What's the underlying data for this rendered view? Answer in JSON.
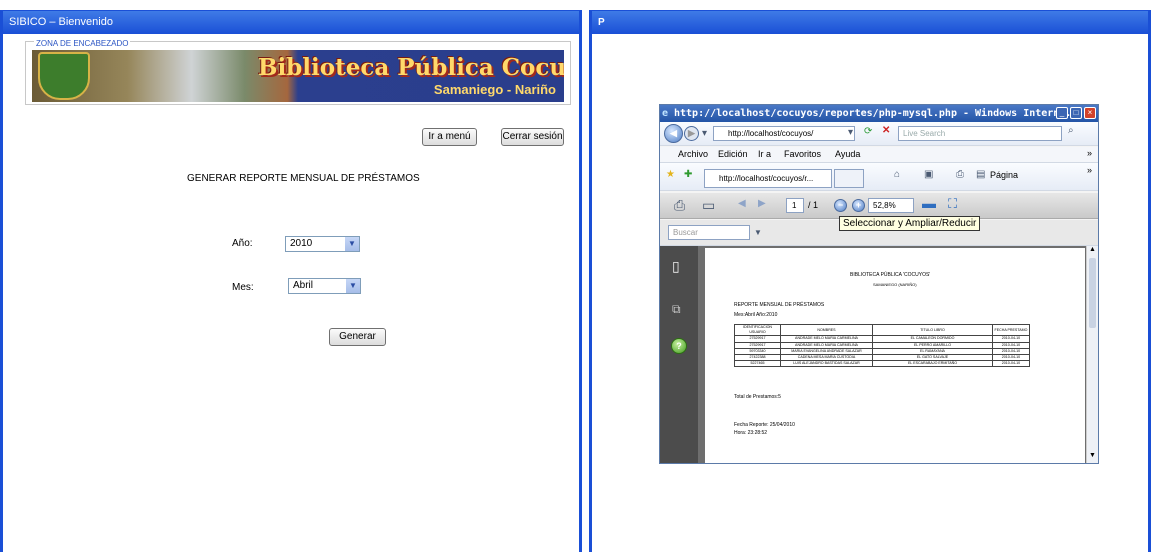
{
  "left": {
    "title": "SIBICO – Bienvenido",
    "header_zone_label": "ZONA DE ENCABEZADO",
    "banner_title": "Biblioteca Pública Cocuyos",
    "banner_subtitle": "Samaniego - Nariño",
    "menu_button": "Ir a menú",
    "logout_button": "Cerrar sesión",
    "page_heading": "GENERAR REPORTE MENSUAL DE PRÉSTAMOS",
    "year_label": "Año:",
    "year_value": "2010",
    "month_label": "Mes:",
    "month_value": "Abril",
    "generate_button": "Generar"
  },
  "right": {
    "title": "P",
    "ie": {
      "title": "http://localhost/cocuyos/reportes/php-mysql.php - Windows Intern...",
      "address": "http://localhost/cocuyos/",
      "search_placeholder": "Live Search",
      "menu": [
        "Archivo",
        "Edición",
        "Ir a",
        "Favoritos",
        "Ayuda"
      ],
      "tab_label": "http://localhost/cocuyos/r...",
      "page_menu": "Página",
      "page_number": "1",
      "page_total": "/ 1",
      "zoom": "52,8%",
      "tooltip": "Seleccionar y Ampliar/Reducir",
      "pdf_search": "Buscar"
    },
    "report": {
      "title": "BIBLIOTECA PÚBLICA 'COCUYOS'",
      "subtitle": "SAMANIEGO (NARIÑO)",
      "heading": "REPORTE MENSUAL DE PRÉSTAMOS",
      "period": "Mes:Abril  Año:2010",
      "columns": [
        "IDENTIFICACION USUARIO",
        "NOMBRES",
        "TITULO LIBRO",
        "FECHA PRESTAMO"
      ],
      "rows": [
        [
          "27529917",
          "ANDRADE MELO MARIA CARMELINA",
          "EL CAMALEON DORMIDO",
          "2010-04-10"
        ],
        [
          "27529917",
          "ANDRADE MELO MARIA CARMELINA",
          "EL PERRO AMARILLO",
          "2010-04-10"
        ],
        [
          "59703340",
          "MARIA EVANGELINA ANDRADE SALAZAR",
          "EL RAMAYANA",
          "2010-04-10"
        ],
        [
          "27422388",
          "CADENA MESA MARIA CUSTODIA",
          "EL GATO SALVAJE",
          "2010-04-10"
        ],
        [
          "5227465",
          "LUIS ALEJANDRO BASTIDAS SALAZAR",
          "EL ESCARABAJO ERMITAÑO",
          "2010-04-10"
        ]
      ],
      "total": "Total de Prestamos:5",
      "report_date": "Fecha Reporte: 25/04/2010",
      "report_time": "Hora: 23:28:52"
    }
  }
}
